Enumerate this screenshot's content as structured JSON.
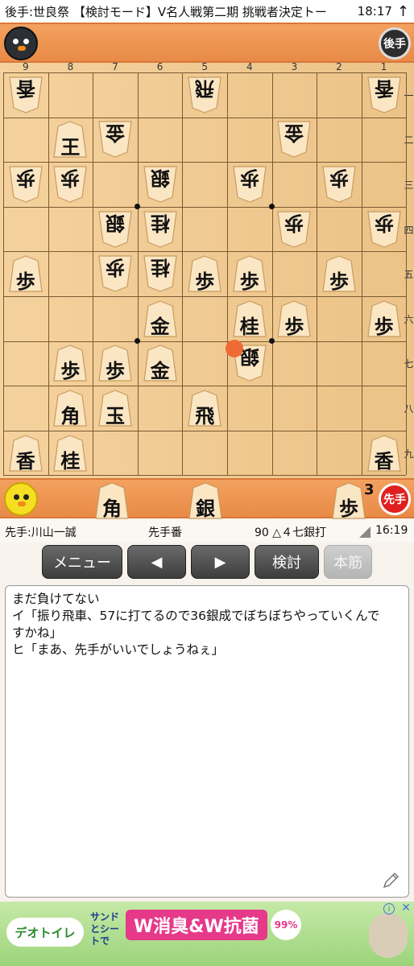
{
  "status_bar": {
    "title": "後手:世良祭 【検討モード】V名人戦第二期 挑戦者決定トー",
    "time": "18:17",
    "arrow": "↑"
  },
  "gote": {
    "turn_badge": "後手",
    "hand": []
  },
  "sente": {
    "turn_badge": "先手",
    "hand": [
      {
        "char": "角"
      },
      {
        "char": "銀"
      },
      {
        "char": "歩",
        "count": "3"
      }
    ]
  },
  "board": {
    "file_labels": [
      "9",
      "8",
      "7",
      "6",
      "5",
      "4",
      "3",
      "2",
      "1"
    ],
    "rank_labels": [
      "一",
      "二",
      "三",
      "四",
      "五",
      "六",
      "七",
      "八",
      "九"
    ],
    "pieces": [
      {
        "file": 9,
        "rank": 1,
        "char": "香",
        "owner": "gote"
      },
      {
        "file": 5,
        "rank": 1,
        "char": "飛",
        "owner": "gote"
      },
      {
        "file": 1,
        "rank": 1,
        "char": "香",
        "owner": "gote"
      },
      {
        "file": 8,
        "rank": 2,
        "char": "王",
        "owner": "sente"
      },
      {
        "file": 7,
        "rank": 2,
        "char": "金",
        "owner": "gote"
      },
      {
        "file": 3,
        "rank": 2,
        "char": "金",
        "owner": "gote"
      },
      {
        "file": 9,
        "rank": 3,
        "char": "歩",
        "owner": "gote"
      },
      {
        "file": 8,
        "rank": 3,
        "char": "歩",
        "owner": "gote"
      },
      {
        "file": 6,
        "rank": 3,
        "char": "銀",
        "owner": "gote"
      },
      {
        "file": 4,
        "rank": 3,
        "char": "歩",
        "owner": "gote"
      },
      {
        "file": 2,
        "rank": 3,
        "char": "歩",
        "owner": "gote"
      },
      {
        "file": 7,
        "rank": 4,
        "char": "銀",
        "owner": "gote"
      },
      {
        "file": 6,
        "rank": 4,
        "char": "桂",
        "owner": "gote"
      },
      {
        "file": 3,
        "rank": 4,
        "char": "歩",
        "owner": "gote"
      },
      {
        "file": 1,
        "rank": 4,
        "char": "歩",
        "owner": "gote"
      },
      {
        "file": 9,
        "rank": 5,
        "char": "歩",
        "owner": "sente"
      },
      {
        "file": 7,
        "rank": 5,
        "char": "歩",
        "owner": "gote"
      },
      {
        "file": 6,
        "rank": 5,
        "char": "桂",
        "owner": "gote"
      },
      {
        "file": 5,
        "rank": 5,
        "char": "歩",
        "owner": "sente"
      },
      {
        "file": 4,
        "rank": 5,
        "char": "歩",
        "owner": "sente"
      },
      {
        "file": 2,
        "rank": 5,
        "char": "歩",
        "owner": "sente"
      },
      {
        "file": 6,
        "rank": 6,
        "char": "金",
        "owner": "sente"
      },
      {
        "file": 4,
        "rank": 6,
        "char": "桂",
        "owner": "sente"
      },
      {
        "file": 3,
        "rank": 6,
        "char": "歩",
        "owner": "sente"
      },
      {
        "file": 1,
        "rank": 6,
        "char": "歩",
        "owner": "sente"
      },
      {
        "file": 8,
        "rank": 7,
        "char": "歩",
        "owner": "sente"
      },
      {
        "file": 7,
        "rank": 7,
        "char": "歩",
        "owner": "sente"
      },
      {
        "file": 6,
        "rank": 7,
        "char": "金",
        "owner": "sente"
      },
      {
        "file": 4,
        "rank": 7,
        "char": "銀",
        "owner": "gote"
      },
      {
        "file": 8,
        "rank": 8,
        "char": "角",
        "owner": "sente"
      },
      {
        "file": 7,
        "rank": 8,
        "char": "玉",
        "owner": "sente"
      },
      {
        "file": 5,
        "rank": 8,
        "char": "飛",
        "owner": "sente"
      },
      {
        "file": 9,
        "rank": 9,
        "char": "香",
        "owner": "sente"
      },
      {
        "file": 8,
        "rank": 9,
        "char": "桂",
        "owner": "sente"
      },
      {
        "file": 1,
        "rank": 9,
        "char": "香",
        "owner": "sente"
      }
    ],
    "last_move": {
      "file": 4,
      "rank": 7
    }
  },
  "info_bar": {
    "sente_player": "先手:川山一誠",
    "turn": "先手番",
    "move": "90 △４七銀打",
    "time": "16:19"
  },
  "buttons": {
    "menu": "メニュー",
    "prev": "◀",
    "next": "▶",
    "analyze": "検討",
    "mainline": "本筋"
  },
  "comment": {
    "lines": [
      "まだ負けてない",
      "イ「振り飛車、57に打てるので36銀成でぼちぼちやっていくんで\nすかね」",
      "ヒ「まあ、先手がいいでしょうねぇ」"
    ]
  },
  "ad": {
    "brand": "デオトイレ",
    "sub": "サンドとシートで",
    "headline": "W消臭&W抗菌",
    "percent": "99%",
    "info_icon": "i",
    "close_icon": "✕"
  }
}
